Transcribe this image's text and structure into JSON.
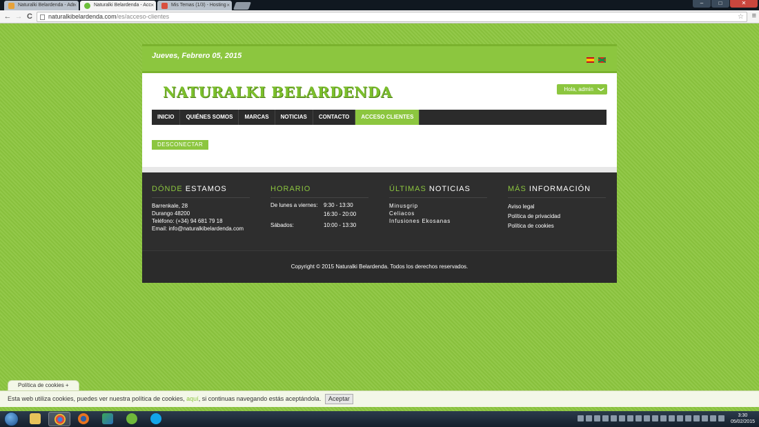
{
  "browser": {
    "tabs": [
      {
        "label": "Naturalki Belardenda - Adr",
        "favicon_color": "#e8a33a",
        "active": false
      },
      {
        "label": "Naturalki Belardenda - Acc",
        "favicon_color": "#6cbf3a",
        "active": true
      },
      {
        "label": "Mis Temas (1/3) - Hosting",
        "favicon_color": "#d9503f",
        "active": false
      }
    ],
    "tab_close": "×",
    "window_controls": {
      "minimize": "–",
      "maximize": "□",
      "close": "✕"
    },
    "back": "←",
    "forward": "→",
    "reload": "C",
    "url_host": "naturalkibelardenda.com",
    "url_path": "/es/acceso-clientes",
    "star": "☆",
    "menu": "≡"
  },
  "site": {
    "date": "Jueves, Febrero 05, 2015",
    "logo": "NATURALKI BELARDENDA",
    "user_menu": "Hola, admin",
    "user_menu_caret": "❯",
    "nav": [
      "INICIO",
      "QUIÉNES SOMOS",
      "MARCAS",
      "NOTICIAS",
      "CONTACTO",
      "ACCESO CLIENTES"
    ],
    "disconnect": "DESCONECTAR",
    "colors": {
      "accent": "#8cc63f",
      "dark": "#2b2b2b"
    }
  },
  "footer": {
    "where": {
      "title_accent": "DÓNDE",
      "title_rest": " ESTAMOS",
      "lines": [
        "Barrenkale, 28",
        "Durango 48200",
        "Teléfono: (+34) 94 681 79 18",
        "Email: info@naturalkibelardenda.com"
      ]
    },
    "schedule": {
      "title_accent": "HORARIO",
      "rows": [
        [
          "De lunes a viernes:",
          "9:30 - 13:30"
        ],
        [
          "",
          "16:30 - 20:00"
        ],
        [
          "Sábados:",
          "10:00 - 13:30"
        ]
      ]
    },
    "news": {
      "title_accent": "ÚLTIMAS",
      "title_rest": " NOTICIAS",
      "items": [
        "Minusgrip",
        "Celiacos",
        "Infusiones Ekosanas"
      ]
    },
    "info": {
      "title_accent": "MÁS",
      "title_rest": " INFORMACIÓN",
      "links": [
        "Aviso legal",
        "Política de privacidad",
        "Política de cookies"
      ]
    },
    "copyright": "Copyright © 2015 Naturalki Belardenda. Todos los derechos reservados."
  },
  "cookies": {
    "tab": "Política de cookies +",
    "text_before": "Esta web utiliza cookies, puedes ver nuestra política de cookies, ",
    "link": "aquí",
    "text_after": ", si continuas navegando estás aceptándola.",
    "accept": "Aceptar"
  },
  "taskbar": {
    "time": "3:30",
    "date": "05/02/2015"
  }
}
